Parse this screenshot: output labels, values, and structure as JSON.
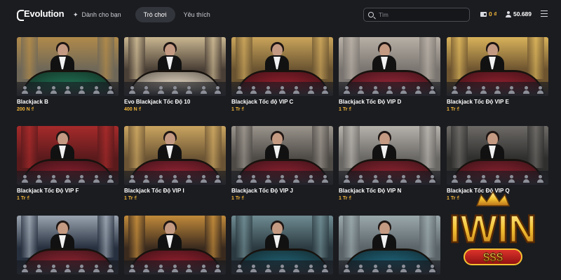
{
  "brand": {
    "name": "Evolution"
  },
  "nav": {
    "for_you": "Dành cho bạn",
    "games": "Trò chơi",
    "favorites": "Yêu thích"
  },
  "search": {
    "placeholder": "Tìm"
  },
  "header": {
    "balance": "0 ₫",
    "players": "50.689"
  },
  "games": [
    {
      "title": "Blackjack B",
      "bet": "200 N ₫",
      "felt": "#1f6b4f",
      "room": "#6e6758",
      "accent": "#b08a4a"
    },
    {
      "title": "Evo Blackjack Tốc Độ 10",
      "bet": "400 N ₫",
      "felt": "#d8cbb8",
      "room": "#4a3f36",
      "accent": "#c9b690"
    },
    {
      "title": "Blackjack Tốc độ VIP C",
      "bet": "1 Tr ₫",
      "felt": "#8d1e2c",
      "room": "#6a5431",
      "accent": "#c9a45a"
    },
    {
      "title": "Blackjack Tốc Độ VIP D",
      "bet": "1 Tr ₫",
      "felt": "#8c2434",
      "room": "#7a7570",
      "accent": "#b8b0a6"
    },
    {
      "title": "Blackjack Tốc Độ VIP E",
      "bet": "1 Tr ₫",
      "felt": "#8a1f2d",
      "room": "#6e5530",
      "accent": "#d8b25a"
    },
    {
      "title": "Blackjack Tốc Độ VIP F",
      "bet": "1 Tr ₫",
      "felt": "#7e1e2b",
      "room": "#5a1a1c",
      "accent": "#a62a2a"
    },
    {
      "title": "Blackjack Tốc Độ VIP I",
      "bet": "1 Tr ₫",
      "felt": "#8c2232",
      "room": "#6b5434",
      "accent": "#caa560"
    },
    {
      "title": "Blackjack Tốc Độ VIP J",
      "bet": "1 Tr ₫",
      "felt": "#84202f",
      "room": "#4e4a46",
      "accent": "#9a948c"
    },
    {
      "title": "Blackjack Tốc Độ VIP N",
      "bet": "1 Tr ₫",
      "felt": "#86222f",
      "room": "#6a6865",
      "accent": "#b6b2ac"
    },
    {
      "title": "Blackjack Tốc Độ VIP Q",
      "bet": "1 Tr ₫",
      "felt": "#7f202d",
      "room": "#2f2f2e",
      "accent": "#6d6a66"
    },
    {
      "title": "",
      "bet": "",
      "felt": "#84222f",
      "room": "#27303e",
      "accent": "#9aa3b0"
    },
    {
      "title": "",
      "bet": "",
      "felt": "#8a1e2c",
      "room": "#3a2a1e",
      "accent": "#c18a3a"
    },
    {
      "title": "",
      "bet": "",
      "felt": "#1f5a6a",
      "room": "#2b3a40",
      "accent": "#6f8b92"
    },
    {
      "title": "",
      "bet": "",
      "felt": "#1d5f74",
      "room": "#5b6468",
      "accent": "#9aa8ac"
    }
  ],
  "watermark": {
    "text": "IWIN",
    "sub": "$$$"
  },
  "colors": {
    "background": "#1b1c20",
    "gold": "#f2b63a",
    "pill": "#33353c"
  }
}
